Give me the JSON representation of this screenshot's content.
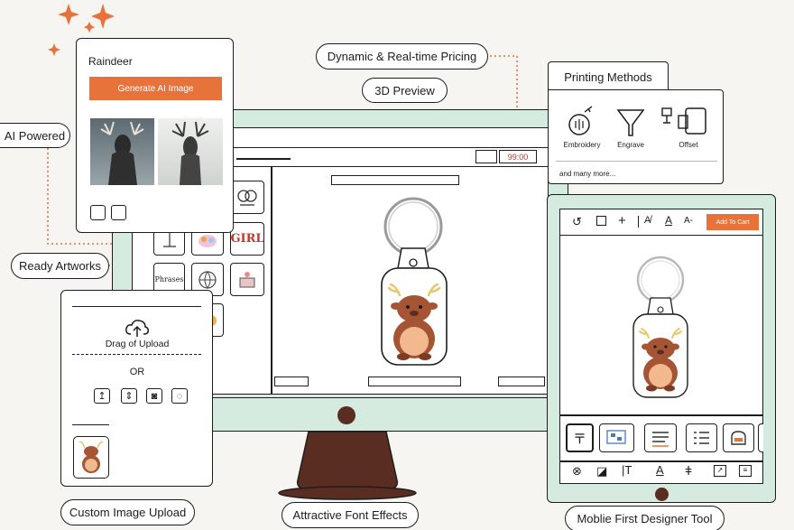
{
  "labels": {
    "ai_powered": "AI Powered",
    "ready_artworks": "Ready Artworks",
    "custom_image_upload": "Custom Image Upload",
    "attractive_font_effects": "Attractive Font Effects",
    "mobile_first": "Moblie First Designer Tool",
    "dynamic_pricing": "Dynamic & Real-time Pricing",
    "preview_3d": "3D Preview"
  },
  "ai_card": {
    "prompt": "Raindeer",
    "button": "Generate AI Image"
  },
  "price": "99:00",
  "printing": {
    "title": "Printing Methods",
    "methods": [
      "Embroidery",
      "Engrave",
      "Offset"
    ],
    "more": "and many more..."
  },
  "upload": {
    "drag": "Drag of Upload",
    "or": "OR"
  },
  "mobile": {
    "add_to_cart": "Add To Cart"
  },
  "artworks": {
    "girl_text": "GIRL",
    "phrases_text": "Phrases"
  },
  "colors": {
    "accent": "#e8733a",
    "monitor": "#d6ebe0",
    "stand": "#5a2d22",
    "deer": "#a55434",
    "belly": "#f2b98e"
  },
  "icons": [
    "sparkle-icon",
    "upload-cloud-icon",
    "embroidery-icon",
    "engrave-icon",
    "offset-icon"
  ]
}
